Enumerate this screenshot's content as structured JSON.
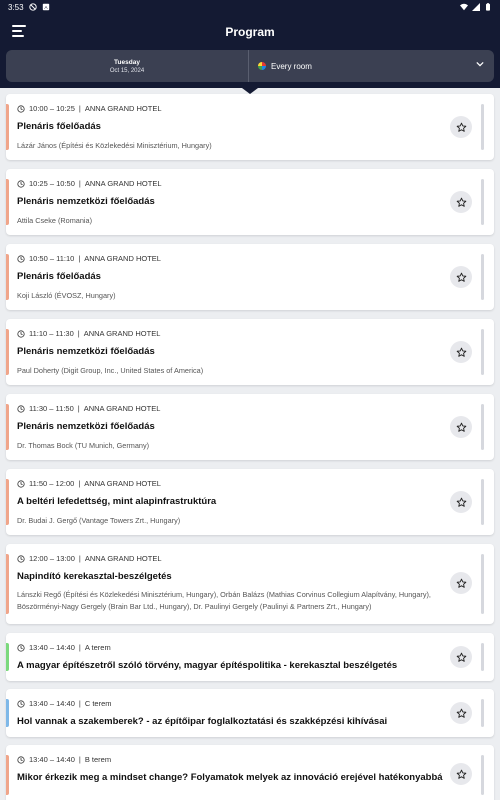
{
  "status": {
    "time": "3:53"
  },
  "appbar": {
    "title": "Program"
  },
  "filter": {
    "day": "Tuesday",
    "date": "Oct 15, 2024",
    "room": "Every room"
  },
  "colors": {
    "orange": "#f0a58a",
    "green": "#7bd97d",
    "blue": "#7fb8e8"
  },
  "sessions": [
    {
      "time": "10:00 – 10:25",
      "room": "ANNA GRAND HOTEL",
      "title": "Plenáris főelőadás",
      "speakers": "Lázár János (Építési és Közlekedési Minisztérium, Hungary)",
      "accent": "orange"
    },
    {
      "time": "10:25 – 10:50",
      "room": "ANNA GRAND HOTEL",
      "title": "Plenáris nemzetközi főelőadás",
      "speakers": "Attila Cseke (Romania)",
      "accent": "orange"
    },
    {
      "time": "10:50 – 11:10",
      "room": "ANNA GRAND HOTEL",
      "title": "Plenáris főelőadás",
      "speakers": "Koji László (ÉVOSZ, Hungary)",
      "accent": "orange"
    },
    {
      "time": "11:10 – 11:30",
      "room": "ANNA GRAND HOTEL",
      "title": "Plenáris nemzetközi főelőadás",
      "speakers": "Paul Doherty (Digit Group, Inc., United States of America)",
      "accent": "orange"
    },
    {
      "time": "11:30 – 11:50",
      "room": "ANNA GRAND HOTEL",
      "title": "Plenáris nemzetközi főelőadás",
      "speakers": "Dr. Thomas Bock (TU Munich, Germany)",
      "accent": "orange"
    },
    {
      "time": "11:50 – 12:00",
      "room": "ANNA GRAND HOTEL",
      "title": "A beltéri lefedettség, mint alapinfrastruktúra",
      "speakers": "Dr. Budai J. Gergő (Vantage Towers Zrt., Hungary)",
      "accent": "orange"
    },
    {
      "time": "12:00 – 13:00",
      "room": "ANNA GRAND HOTEL",
      "title": "Napindító kerekasztal-beszélgetés",
      "speakers": "Lánszki Regő (Építési és Közlekedési Minisztérium, Hungary), Orbán Balázs (Mathias Corvinus Collegium Alapítvány, Hungary), Böszörményi-Nagy Gergely (Brain Bar Ltd., Hungary), Dr. Paulinyi Gergely (Paulinyi & Partners Zrt., Hungary)",
      "accent": "orange"
    },
    {
      "time": "13:40 – 14:40",
      "room": "A terem",
      "title": "A magyar építészetről szóló törvény, magyar építéspolitika - kerekasztal beszélgetés",
      "speakers": "",
      "accent": "green"
    },
    {
      "time": "13:40 – 14:40",
      "room": "C terem",
      "title": "Hol vannak a szakemberek? - az építőipar foglalkoztatási és szakképzési kihívásai",
      "speakers": "",
      "accent": "blue"
    },
    {
      "time": "13:40 – 14:40",
      "room": "B terem",
      "title": "Mikor érkezik meg a mindset change? Folyamatok melyek az innováció erejével hatékonyabbá",
      "speakers": "",
      "accent": "orange"
    }
  ]
}
